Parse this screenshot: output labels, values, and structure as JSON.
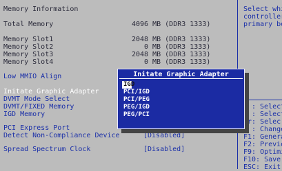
{
  "main": {
    "section_title": "Memory Information",
    "memory_rows": [
      {
        "label": "Total Memory",
        "value": "4096 MB (DDR3 1333)"
      },
      {
        "label": "Memory Slot1",
        "value": "2048 MB (DDR3 1333)"
      },
      {
        "label": "Memory Slot2",
        "value": "0 MB (DDR3 1333)"
      },
      {
        "label": "Memory Slot3",
        "value": "2048 MB (DDR3 1333)"
      },
      {
        "label": "Memory Slot4",
        "value": "0 MB (DDR3 1333)"
      }
    ],
    "low_mmio": "Low MMIO Align",
    "initiate_graphic": "Initate Graphic Adapter",
    "dvmt_mode": "DVMT Mode Select",
    "dvmt_fixed": "DVMT/FIXED Memory",
    "igd_memory": "IGD Memory",
    "pci_express_port": "PCI Express Port",
    "detect_noncompliance": "Detect Non-Compliance Device",
    "detect_value": "[Disabled]",
    "spread_spectrum": "Spread Spectrum Clock",
    "spread_value": "[Disabled]"
  },
  "popup": {
    "title": "Initate Graphic Adapter",
    "options": [
      "IGD",
      "PCI/IGD",
      "PCI/PEG",
      "PEG/IGD",
      "PEG/PCI"
    ],
    "selected_index": 0
  },
  "help": {
    "lines": [
      "Select whi",
      "controller",
      "primary bo"
    ],
    "keys": [
      ": Select",
      ": Select",
      "ter: Selec",
      ": Change",
      "F1: Genera",
      "F2: Previo",
      "F9: Optimi",
      "F10: Save",
      "ESC: Exit"
    ]
  }
}
